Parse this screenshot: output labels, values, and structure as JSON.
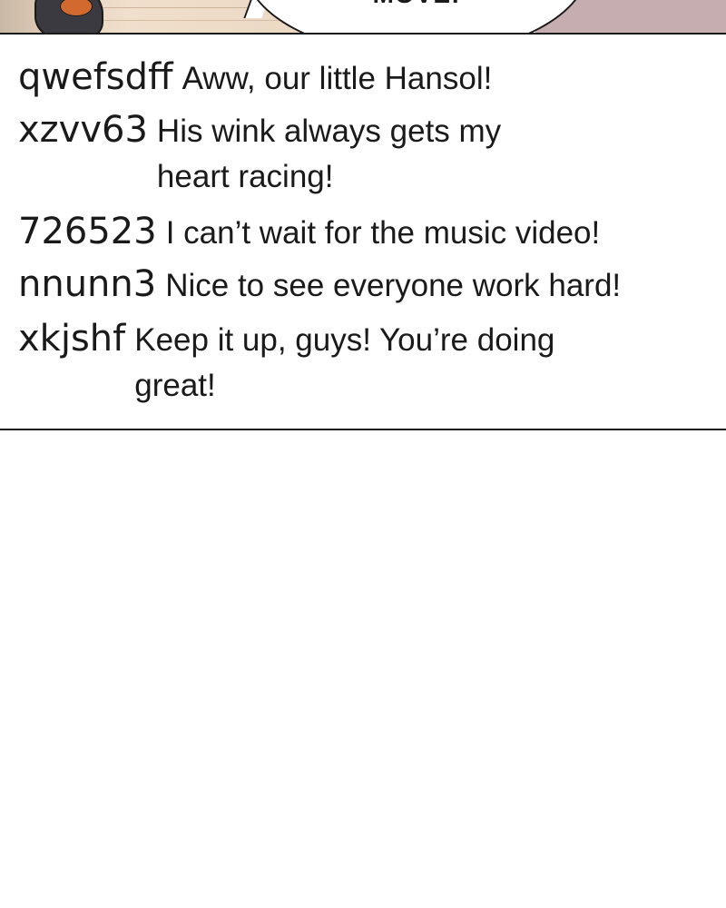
{
  "panel": {
    "bubble_text": "MOVE!"
  },
  "comments": [
    {
      "username": "qwefsdff",
      "message": "Aww, our little Hansol!"
    },
    {
      "username": "xzvv63",
      "message": "His wink always gets my heart racing!"
    },
    {
      "username": "726523",
      "message": "I can’t wait for the music video!"
    },
    {
      "username": "nnunn3",
      "message": "Nice to see everyone work hard!"
    },
    {
      "username": "xkjshf",
      "message": "Keep it up, guys! You’re doing great!"
    }
  ]
}
